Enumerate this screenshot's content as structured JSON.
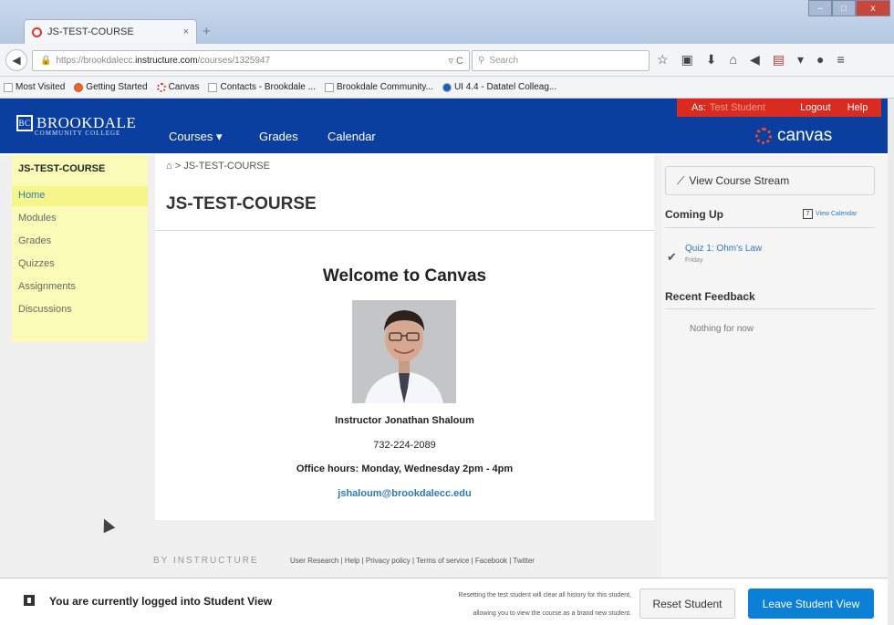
{
  "browser": {
    "tab_title": "JS-TEST-COURSE",
    "tab_close": "×",
    "new_tab": "+",
    "window_buttons": [
      "–",
      "□",
      "x"
    ],
    "url_prefix": "https://brookdalecc.",
    "url_host": "instructure.com",
    "url_path": "/courses/1325947",
    "search_placeholder": "Search",
    "bookmarks": [
      {
        "label": "Most Visited",
        "icon": "bookmark-folder-icon"
      },
      {
        "label": "Getting Started",
        "icon": "firefox-icon"
      },
      {
        "label": "Canvas",
        "icon": "canvas-icon"
      },
      {
        "label": "Contacts - Brookdale ...",
        "icon": "page-icon"
      },
      {
        "label": "Brookdale Community...",
        "icon": "page-icon"
      },
      {
        "label": "UI 4.4 - Datatel Colleag...",
        "icon": "datatel-icon"
      }
    ]
  },
  "header": {
    "logo_name": "BROOKDALE",
    "logo_sub": "COMMUNITY COLLEGE",
    "nav": [
      "Courses ▾",
      "Grades",
      "Calendar"
    ],
    "as_label": "As:",
    "as_user": "Test Student",
    "logout": "Logout",
    "help": "Help",
    "canvas_brand": "canvas",
    "brand_color": "#0a3f9f",
    "alert_color": "#d92b1f"
  },
  "course_nav": {
    "title": "JS-TEST-COURSE",
    "items": [
      "Home",
      "Modules",
      "Grades",
      "Quizzes",
      "Assignments",
      "Discussions"
    ],
    "active": "Home"
  },
  "main": {
    "breadcrumb": "JS-TEST-COURSE",
    "page_title": "JS-TEST-COURSE",
    "welcome": "Welcome to Canvas",
    "instructor": "Instructor Jonathan Shaloum",
    "phone": "732-224-2089",
    "office_hours": "Office hours: Monday, Wednesday 2pm - 4pm",
    "email": "jshaloum@brookdalecc.edu"
  },
  "sidebar": {
    "stream_button": "View Course Stream",
    "coming_up": "Coming Up",
    "view_calendar": "View Calendar",
    "upcoming_item": "Quiz 1: Ohm's Law",
    "upcoming_date": "Friday",
    "recent_feedback": "Recent Feedback",
    "nothing": "Nothing for now"
  },
  "footer": {
    "by": "BY INSTRUCTURE",
    "links": "User Research | Help | Privacy policy | Terms of service | Facebook | Twitter"
  },
  "student_view": {
    "message": "You are currently logged into Student View",
    "note_line1": "Resetting the test student will clear all history for this student,",
    "note_line2": "allowing you to view the course as a brand new student.",
    "reset": "Reset Student",
    "leave": "Leave Student View",
    "leave_color": "#0b80d6"
  }
}
